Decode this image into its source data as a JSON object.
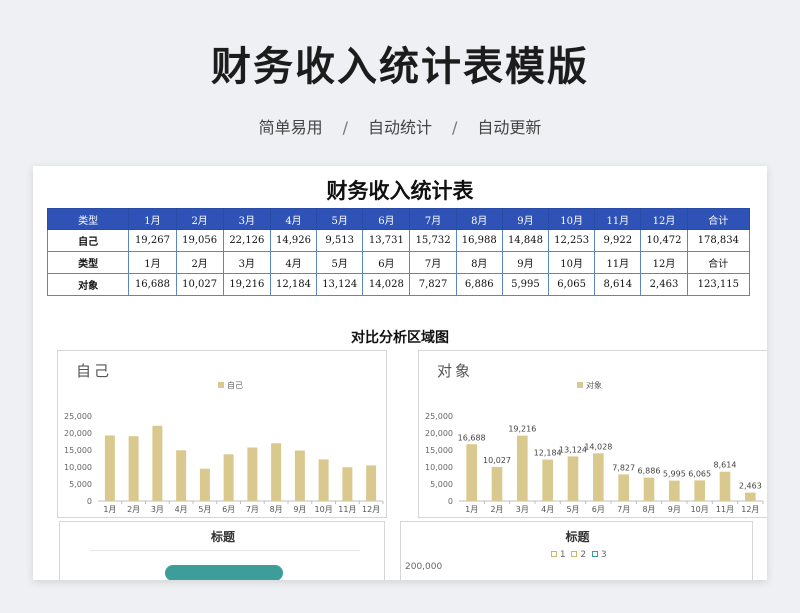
{
  "header": {
    "title": "财务收入统计表模版",
    "subtitle": [
      "简单易用",
      "自动统计",
      "自动更新"
    ],
    "separator": "/"
  },
  "sheet": {
    "title": "财务收入统计表",
    "section_title": "对比分析区域图",
    "table": {
      "header_label": "类型",
      "months": [
        "1月",
        "2月",
        "3月",
        "4月",
        "5月",
        "6月",
        "7月",
        "8月",
        "9月",
        "10月",
        "11月",
        "12月"
      ],
      "total_label": "合计",
      "rows": [
        {
          "label": "自己",
          "values": [
            "19,267",
            "19,056",
            "22,126",
            "14,926",
            "9,513",
            "13,731",
            "15,732",
            "16,988",
            "14,848",
            "12,253",
            "9,922",
            "10,472"
          ],
          "total": "178,834"
        },
        {
          "label": "类型",
          "values": [
            "1月",
            "2月",
            "3月",
            "4月",
            "5月",
            "6月",
            "7月",
            "8月",
            "9月",
            "10月",
            "11月",
            "12月"
          ],
          "total": "合计"
        },
        {
          "label": "对象",
          "values": [
            "16,688",
            "10,027",
            "19,216",
            "12,184",
            "13,124",
            "14,028",
            "7,827",
            "6,886",
            "5,995",
            "6,065",
            "8,614",
            "2,463"
          ],
          "total": "123,115"
        }
      ]
    },
    "bottom_left_title": "标题",
    "bottom_right_title": "标题",
    "bottom_right_legend": [
      "1",
      "2",
      "3"
    ],
    "bottom_right_axis_top": "200,000"
  },
  "chart_data": [
    {
      "type": "bar",
      "title": "自己",
      "legend": [
        "自己"
      ],
      "categories": [
        "1月",
        "2月",
        "3月",
        "4月",
        "5月",
        "6月",
        "7月",
        "8月",
        "9月",
        "10月",
        "11月",
        "12月"
      ],
      "series": [
        {
          "name": "自己",
          "values": [
            19267,
            19056,
            22126,
            14926,
            9513,
            13731,
            15732,
            16988,
            14848,
            12253,
            9922,
            10472
          ]
        }
      ],
      "ylim": [
        0,
        25000
      ],
      "yticks": [
        "0",
        "5,000",
        "10,000",
        "15,000",
        "20,000",
        "25,000"
      ],
      "data_labels": false,
      "bar_color": "#d9c98f"
    },
    {
      "type": "bar",
      "title": "对象",
      "legend": [
        "对象"
      ],
      "categories": [
        "1月",
        "2月",
        "3月",
        "4月",
        "5月",
        "6月",
        "7月",
        "8月",
        "9月",
        "10月",
        "11月",
        "12月"
      ],
      "series": [
        {
          "name": "对象",
          "values": [
            16688,
            10027,
            19216,
            12184,
            13124,
            14028,
            7827,
            6886,
            5995,
            6065,
            8614,
            2463
          ]
        }
      ],
      "ylim": [
        0,
        25000
      ],
      "yticks": [
        "0",
        "5,000",
        "10,000",
        "15,000",
        "20,000",
        "25,000"
      ],
      "data_labels": true,
      "bar_color": "#d9c98f"
    }
  ]
}
